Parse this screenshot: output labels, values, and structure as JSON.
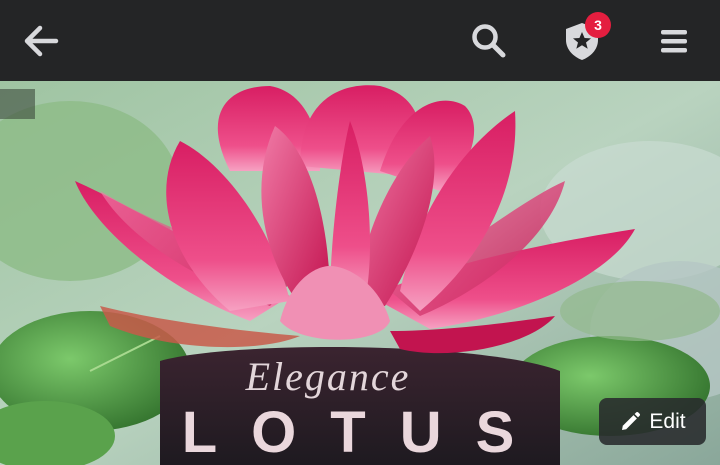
{
  "header": {
    "back_icon": "arrow-left-icon",
    "search_icon": "search-icon",
    "shield_icon": "shield-star-icon",
    "notification_count": "3",
    "menu_icon": "hamburger-menu-icon"
  },
  "cover": {
    "subtitle": "Elegance",
    "title": "LOTUS",
    "edit_label": "Edit",
    "edit_icon": "pencil-icon"
  },
  "colors": {
    "topbar": "#242526",
    "icon": "#d8d9dc",
    "badge": "#e41e3f",
    "petal": "#e0306f",
    "leaf": "#4f9a3f"
  }
}
